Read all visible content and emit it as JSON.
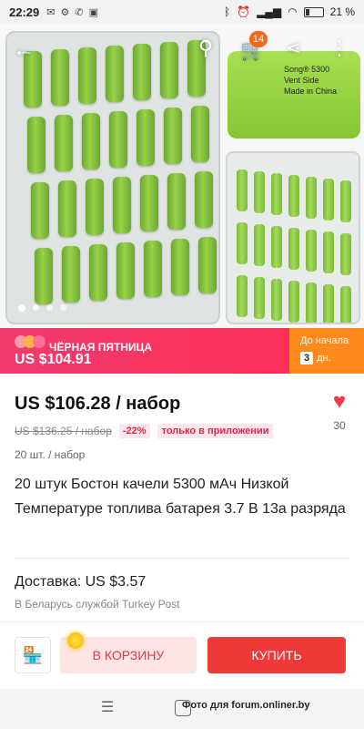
{
  "status": {
    "time": "22:29",
    "battery": "21 %"
  },
  "header": {
    "cart_count": "14",
    "pack_label_1": "Song® 5300",
    "pack_label_2": "Vent Side",
    "pack_label_3": "Made in China"
  },
  "gallery": {
    "slide_count": 4,
    "active_slide": 1
  },
  "promo": {
    "title": "ЧЁРНАЯ ПЯТНИЦА",
    "price": "US $104.91",
    "countdown_caption": "До начала",
    "countdown_value": "3",
    "countdown_unit": "дн."
  },
  "product": {
    "price": "US $106.28 / набор",
    "old_price": "US $136.25 / набор",
    "discount": "-22%",
    "app_only": "только в приложении",
    "likes": "30",
    "quantity": "20 шт. / набор",
    "title": "20 штук Бостон качели 5300 мАч Низкой Температуре топлива батарея 3.7 В 13а разряда"
  },
  "delivery": {
    "label": "Доставка: US $3.57",
    "sub": "В Беларусь службой Turkey Post"
  },
  "actions": {
    "cart_label": "В КОРЗИНУ",
    "buy_label": "КУПИТЬ"
  },
  "watermark": "Фото для forum.onliner.by",
  "colors": {
    "accent": "#ef3838",
    "promo_pink": "#ff2d55",
    "promo_orange": "#ff8a1c",
    "like_red": "#f0384f"
  }
}
